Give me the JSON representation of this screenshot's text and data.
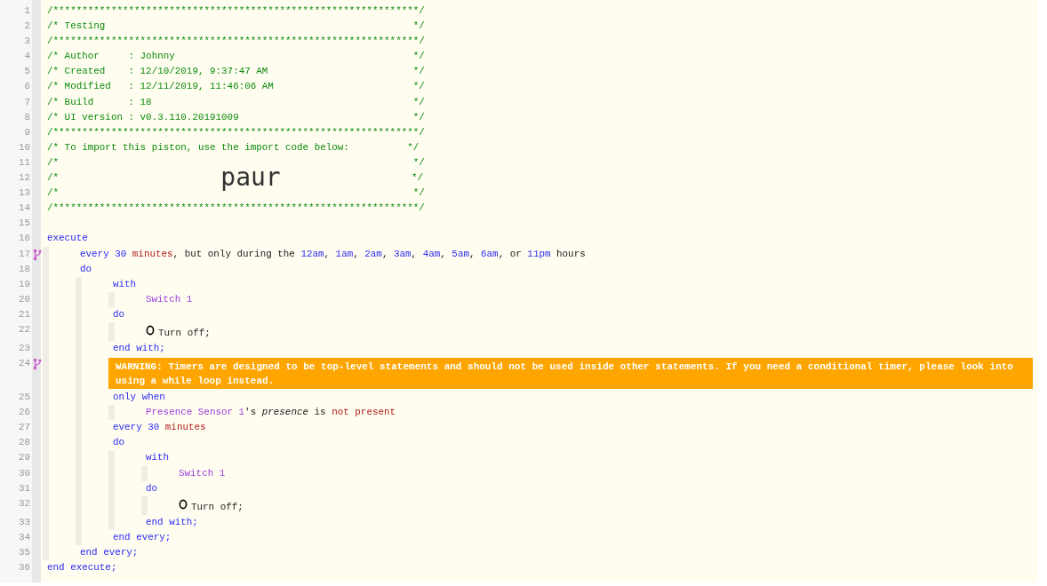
{
  "lines": [
    {
      "number": "1",
      "kind": "code",
      "parts": [
        {
          "kind": "comment",
          "text": "/***************************************************************/"
        }
      ]
    },
    {
      "number": "2",
      "kind": "code",
      "parts": [
        {
          "kind": "comment",
          "text": "/* Testing                                                     */"
        }
      ]
    },
    {
      "number": "3",
      "kind": "code",
      "parts": [
        {
          "kind": "comment",
          "text": "/***************************************************************/"
        }
      ]
    },
    {
      "number": "4",
      "kind": "code",
      "parts": [
        {
          "kind": "comment",
          "text": "/* Author     : Johnny                                         */"
        }
      ]
    },
    {
      "number": "5",
      "kind": "code",
      "parts": [
        {
          "kind": "comment",
          "text": "/* Created    : 12/10/2019, 9:37:47 AM                         */"
        }
      ]
    },
    {
      "number": "6",
      "kind": "code",
      "parts": [
        {
          "kind": "comment",
          "text": "/* Modified   : 12/11/2019, 11:46:06 AM                        */"
        }
      ]
    },
    {
      "number": "7",
      "kind": "code",
      "parts": [
        {
          "kind": "comment",
          "text": "/* Build      : 18                                             */"
        }
      ]
    },
    {
      "number": "8",
      "kind": "code",
      "parts": [
        {
          "kind": "comment",
          "text": "/* UI version : v0.3.110.20191009                              */"
        }
      ]
    },
    {
      "number": "9",
      "kind": "code",
      "parts": [
        {
          "kind": "comment",
          "text": "/***************************************************************/"
        }
      ]
    },
    {
      "number": "10",
      "kind": "code",
      "parts": [
        {
          "kind": "comment",
          "text": "/* To import this piston, use the import code below:          */"
        }
      ]
    },
    {
      "number": "11",
      "kind": "code",
      "parts": [
        {
          "kind": "comment",
          "text": "/*                                                             */"
        }
      ]
    },
    {
      "number": "12",
      "kind": "banner",
      "left": "/*",
      "code": "paur",
      "right": "*/"
    },
    {
      "number": "13",
      "kind": "code",
      "parts": [
        {
          "kind": "comment",
          "text": "/*                                                             */"
        }
      ]
    },
    {
      "number": "14",
      "kind": "code",
      "parts": [
        {
          "kind": "comment",
          "text": "/***************************************************************/"
        }
      ]
    },
    {
      "number": "15",
      "kind": "blank"
    },
    {
      "number": "16",
      "kind": "code",
      "parts": [
        {
          "kind": "keyword",
          "text": "execute"
        }
      ],
      "children": [
        {
          "number": "17",
          "kind": "code",
          "marker": true,
          "parts": [
            {
              "kind": "keyword",
              "text": "every "
            },
            {
              "kind": "value",
              "text": "30"
            },
            {
              "kind": "unit",
              "text": " minutes"
            },
            {
              "kind": "plain",
              "text": ", but only during the "
            },
            {
              "kind": "value",
              "text": "12am"
            },
            {
              "kind": "plain",
              "text": ", "
            },
            {
              "kind": "value",
              "text": "1am"
            },
            {
              "kind": "plain",
              "text": ", "
            },
            {
              "kind": "value",
              "text": "2am"
            },
            {
              "kind": "plain",
              "text": ", "
            },
            {
              "kind": "value",
              "text": "3am"
            },
            {
              "kind": "plain",
              "text": ", "
            },
            {
              "kind": "value",
              "text": "4am"
            },
            {
              "kind": "plain",
              "text": ", "
            },
            {
              "kind": "value",
              "text": "5am"
            },
            {
              "kind": "plain",
              "text": ", "
            },
            {
              "kind": "value",
              "text": "6am"
            },
            {
              "kind": "plain",
              "text": ", or "
            },
            {
              "kind": "value",
              "text": "11pm"
            },
            {
              "kind": "plain",
              "text": " hours"
            }
          ]
        },
        {
          "number": "18",
          "kind": "code",
          "parts": [
            {
              "kind": "keyword",
              "text": "do"
            }
          ],
          "children": [
            {
              "number": "19",
              "kind": "code",
              "parts": [
                {
                  "kind": "keyword",
                  "text": "with"
                }
              ],
              "children": [
                {
                  "number": "20",
                  "kind": "code",
                  "parts": [
                    {
                      "kind": "device",
                      "text": "Switch 1"
                    }
                  ]
                }
              ]
            },
            {
              "number": "21",
              "kind": "code",
              "parts": [
                {
                  "kind": "keyword",
                  "text": "do"
                }
              ],
              "children": [
                {
                  "number": "22",
                  "kind": "task",
                  "parts": [
                    {
                      "kind": "plain",
                      "text": "Turn off;"
                    }
                  ]
                }
              ]
            },
            {
              "number": "23",
              "kind": "code",
              "parts": [
                {
                  "kind": "keyword",
                  "text": "end with;"
                }
              ]
            },
            {
              "number": "24",
              "kind": "warning",
              "marker": true,
              "text": "WARNING: Timers are designed to be top-level statements and should not be used inside other statements. If you need a conditional timer, please look into using a while loop instead."
            },
            {
              "number": "25",
              "kind": "code",
              "parts": [
                {
                  "kind": "keyword",
                  "text": "only when"
                }
              ],
              "children": [
                {
                  "number": "26",
                  "kind": "code",
                  "parts": [
                    {
                      "kind": "device",
                      "text": "Presence Sensor 1"
                    },
                    {
                      "kind": "plain",
                      "text": "'s "
                    },
                    {
                      "kind": "attribute",
                      "text": "presence"
                    },
                    {
                      "kind": "plain",
                      "text": " is "
                    },
                    {
                      "kind": "unit",
                      "text": "not present"
                    }
                  ]
                }
              ]
            },
            {
              "number": "27",
              "kind": "code",
              "parts": [
                {
                  "kind": "keyword",
                  "text": "every "
                },
                {
                  "kind": "value",
                  "text": "30"
                },
                {
                  "kind": "unit",
                  "text": " minutes"
                }
              ]
            },
            {
              "number": "28",
              "kind": "code",
              "parts": [
                {
                  "kind": "keyword",
                  "text": "do"
                }
              ],
              "children": [
                {
                  "number": "29",
                  "kind": "code",
                  "parts": [
                    {
                      "kind": "keyword",
                      "text": "with"
                    }
                  ],
                  "children": [
                    {
                      "number": "30",
                      "kind": "code",
                      "parts": [
                        {
                          "kind": "device",
                          "text": "Switch 1"
                        }
                      ]
                    }
                  ]
                },
                {
                  "number": "31",
                  "kind": "code",
                  "parts": [
                    {
                      "kind": "keyword",
                      "text": "do"
                    }
                  ],
                  "children": [
                    {
                      "number": "32",
                      "kind": "task",
                      "parts": [
                        {
                          "kind": "plain",
                          "text": "Turn off;"
                        }
                      ]
                    }
                  ]
                },
                {
                  "number": "33",
                  "kind": "code",
                  "parts": [
                    {
                      "kind": "keyword",
                      "text": "end with;"
                    }
                  ]
                }
              ]
            },
            {
              "number": "34",
              "kind": "code",
              "parts": [
                {
                  "kind": "keyword",
                  "text": "end every;"
                }
              ]
            }
          ]
        },
        {
          "number": "35",
          "kind": "code",
          "parts": [
            {
              "kind": "keyword",
              "text": "end every;"
            }
          ]
        }
      ]
    },
    {
      "number": "36",
      "kind": "code",
      "parts": [
        {
          "kind": "keyword",
          "text": "end execute;"
        }
      ]
    }
  ]
}
